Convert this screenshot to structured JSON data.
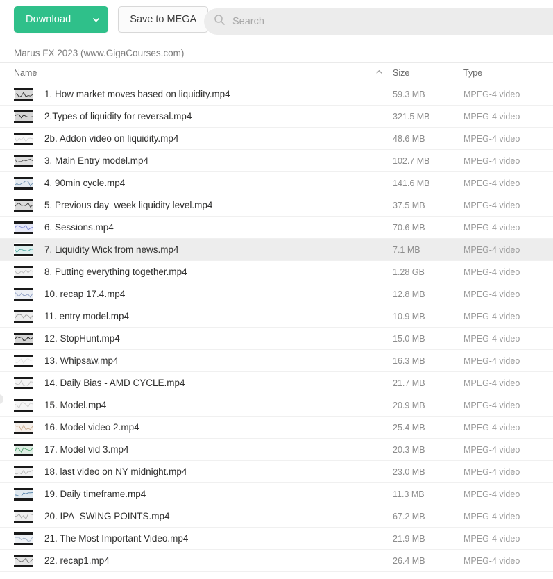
{
  "toolbar": {
    "download_label": "Download",
    "download_dropdown_icon": "chevron-down-icon",
    "save_mega_label": "Save to MEGA",
    "accent_color": "#2fc08a",
    "search": {
      "placeholder": "Search",
      "value": "",
      "icon": "search-icon"
    }
  },
  "breadcrumb": {
    "path": "Marus FX 2023 (www.GigaCourses.com)"
  },
  "table": {
    "columns": {
      "name": "Name",
      "size": "Size",
      "type": "Type"
    },
    "sort": {
      "column": "Name",
      "direction": "ascending",
      "icon": "chevron-up-icon"
    },
    "selected_row_index": 7,
    "selection_color": "#2e9fe0",
    "rows": [
      {
        "name": "1. How market moves based on liquidity.mp4",
        "size": "59.3 MB",
        "type": "MPEG-4 video",
        "thumb": "video-thumbnail",
        "tint": "#2a2a2a"
      },
      {
        "name": "2.Types of liquidity for reversal.mp4",
        "size": "321.5 MB",
        "type": "MPEG-4 video",
        "thumb": "video-thumbnail",
        "tint": "#1d1d1d"
      },
      {
        "name": "2b. Addon video on liquidity.mp4",
        "size": "48.6 MB",
        "type": "MPEG-4 video",
        "thumb": "video-thumbnail",
        "tint": "#d7d7d7"
      },
      {
        "name": "3. Main Entry model.mp4",
        "size": "102.7 MB",
        "type": "MPEG-4 video",
        "thumb": "video-thumbnail",
        "tint": "#555555"
      },
      {
        "name": "4. 90min cycle.mp4",
        "size": "141.6 MB",
        "type": "MPEG-4 video",
        "thumb": "video-thumbnail",
        "tint": "#6d8fb0"
      },
      {
        "name": "5. Previous day_week liquidity level.mp4",
        "size": "37.5 MB",
        "type": "MPEG-4 video",
        "thumb": "video-thumbnail",
        "tint": "#3a3a3a"
      },
      {
        "name": "6. Sessions.mp4",
        "size": "70.6 MB",
        "type": "MPEG-4 video",
        "thumb": "video-thumbnail",
        "tint": "#7b86d6"
      },
      {
        "name": "7. Liquidity Wick from news.mp4",
        "size": "7.1 MB",
        "type": "MPEG-4 video",
        "thumb": "video-thumbnail",
        "tint": "#4aa9a0"
      },
      {
        "name": "8. Putting everything together.mp4",
        "size": "1.28 GB",
        "type": "MPEG-4 video",
        "thumb": "video-thumbnail",
        "tint": "#b9b9b9"
      },
      {
        "name": "10. recap 17.4.mp4",
        "size": "12.8 MB",
        "type": "MPEG-4 video",
        "thumb": "video-thumbnail",
        "tint": "#8f9fc4"
      },
      {
        "name": "11. entry model.mp4",
        "size": "10.9 MB",
        "type": "MPEG-4 video",
        "thumb": "video-thumbnail",
        "tint": "#9a9a9a"
      },
      {
        "name": "12. StopHunt.mp4",
        "size": "15.0 MB",
        "type": "MPEG-4 video",
        "thumb": "video-thumbnail",
        "tint": "#1a1a1a"
      },
      {
        "name": "13. Whipsaw.mp4",
        "size": "16.3 MB",
        "type": "MPEG-4 video",
        "thumb": "video-thumbnail",
        "tint": "#e2e2e2"
      },
      {
        "name": "14. Daily Bias - AMD CYCLE.mp4",
        "size": "21.7 MB",
        "type": "MPEG-4 video",
        "thumb": "video-thumbnail",
        "tint": "#c2c2c2"
      },
      {
        "name": "15. Model.mp4",
        "size": "20.9 MB",
        "type": "MPEG-4 video",
        "thumb": "video-thumbnail",
        "tint": "#cfcfcf"
      },
      {
        "name": "16. Model video 2.mp4",
        "size": "25.4 MB",
        "type": "MPEG-4 video",
        "thumb": "video-thumbnail",
        "tint": "#c9a98a"
      },
      {
        "name": "17. Model vid 3.mp4",
        "size": "20.3 MB",
        "type": "MPEG-4 video",
        "thumb": "video-thumbnail",
        "tint": "#4aa06a"
      },
      {
        "name": "18. last video on NY midnight.mp4",
        "size": "23.0 MB",
        "type": "MPEG-4 video",
        "thumb": "video-thumbnail",
        "tint": "#b5b5b5"
      },
      {
        "name": "19. Daily timeframe.mp4",
        "size": "11.3 MB",
        "type": "MPEG-4 video",
        "thumb": "video-thumbnail",
        "tint": "#4f7fa8"
      },
      {
        "name": "20. IPA_SWING POINTS.mp4",
        "size": "67.2 MB",
        "type": "MPEG-4 video",
        "thumb": "video-thumbnail",
        "tint": "#a8a8a8"
      },
      {
        "name": "21. The Most Important Video.mp4",
        "size": "21.9 MB",
        "type": "MPEG-4 video",
        "thumb": "video-thumbnail",
        "tint": "#9fb0c6"
      },
      {
        "name": "22. recap1.mp4",
        "size": "26.4 MB",
        "type": "MPEG-4 video",
        "thumb": "video-thumbnail",
        "tint": "#6e6e6e"
      }
    ]
  }
}
